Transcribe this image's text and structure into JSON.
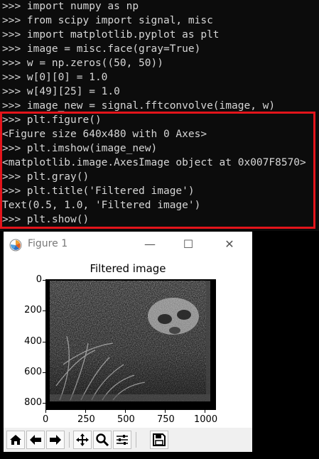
{
  "terminal": {
    "lines": [
      ">>> import numpy as np",
      ">>> from scipy import signal, misc",
      ">>> import matplotlib.pyplot as plt",
      ">>> image = misc.face(gray=True)",
      ">>> w = np.zeros((50, 50))",
      ">>> w[0][0] = 1.0",
      ">>> w[49][25] = 1.0",
      ">>> image_new = signal.fftconvolve(image, w)",
      ">>> plt.figure()",
      "<Figure size 640x480 with 0 Axes>",
      ">>> plt.imshow(image_new)",
      "<matplotlib.image.AxesImage object at 0x007F8570>",
      ">>> plt.gray()",
      ">>> plt.title('Filtered image')",
      "Text(0.5, 1.0, 'Filtered image')",
      ">>> plt.show()"
    ]
  },
  "figure_window": {
    "title": "Figure 1",
    "minimize_glyph": "—",
    "maximize_glyph": "☐",
    "close_glyph": "✕"
  },
  "plot": {
    "title": "Filtered image",
    "y_ticks": [
      "0",
      "200",
      "400",
      "600",
      "800"
    ],
    "x_ticks": [
      "0",
      "250",
      "500",
      "750",
      "1000"
    ]
  },
  "toolbar": {
    "buttons": [
      "home-icon",
      "back-arrow-icon",
      "forward-arrow-icon",
      "pan-icon",
      "zoom-icon",
      "configure-subplots-icon",
      "save-icon"
    ]
  }
}
